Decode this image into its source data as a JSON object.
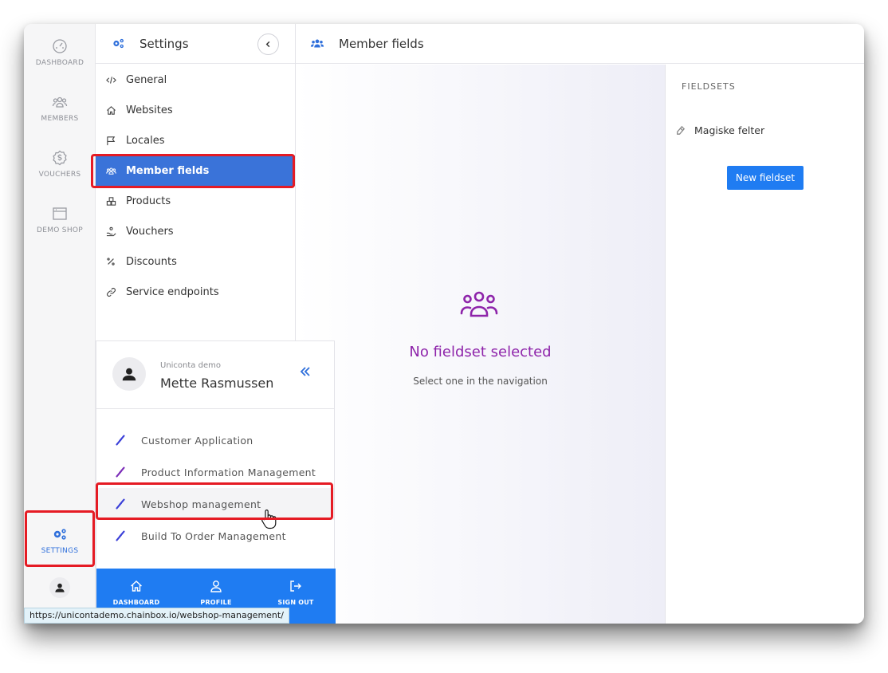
{
  "rail": {
    "items": [
      {
        "label": "DASHBOARD",
        "icon": "gauge-icon"
      },
      {
        "label": "MEMBERS",
        "icon": "users-icon"
      },
      {
        "label": "VOUCHERS",
        "icon": "dollar-badge-icon"
      },
      {
        "label": "DEMO SHOP",
        "icon": "browser-window-icon"
      }
    ],
    "settings_label": "SETTINGS"
  },
  "settings": {
    "title": "Settings",
    "nav": [
      {
        "label": "General",
        "icon": "code-icon"
      },
      {
        "label": "Websites",
        "icon": "home-icon"
      },
      {
        "label": "Locales",
        "icon": "flag-icon"
      },
      {
        "label": "Member fields",
        "icon": "users-icon",
        "active": true
      },
      {
        "label": "Products",
        "icon": "boxes-icon"
      },
      {
        "label": "Vouchers",
        "icon": "hand-coin-icon"
      },
      {
        "label": "Discounts",
        "icon": "percent-icon"
      },
      {
        "label": "Service endpoints",
        "icon": "link-icon"
      }
    ]
  },
  "user": {
    "org": "Uniconta demo",
    "name": "Mette Rasmussen",
    "apps": [
      {
        "label": "Customer Application"
      },
      {
        "label": "Product Information Management"
      },
      {
        "label": "Webshop management"
      },
      {
        "label": "Build To Order Management"
      }
    ],
    "bottom": [
      "DASHBOARD",
      "PROFILE",
      "SIGN OUT"
    ]
  },
  "main": {
    "title": "Member fields",
    "empty_title": "No fieldset selected",
    "empty_sub": "Select one in the navigation"
  },
  "fieldsets": {
    "title": "FIELDSETS",
    "items": [
      "Magiske felter"
    ],
    "new_button": "New fieldset"
  },
  "status_url": "https://unicontademo.chainbox.io/webshop-management/",
  "colors": {
    "accent": "#1f7cf2",
    "active_nav": "#3a73d9",
    "highlight": "#e51b24",
    "empty_title": "#8e24aa"
  }
}
